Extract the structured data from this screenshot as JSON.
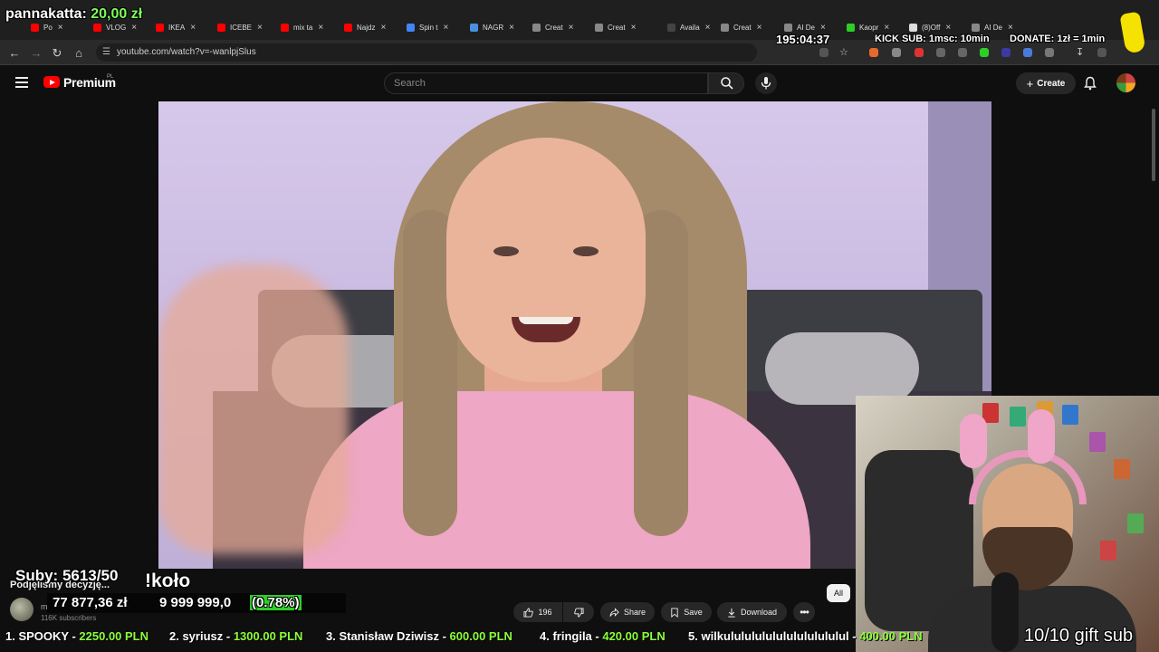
{
  "browser": {
    "tabs": [
      {
        "label": "Po",
        "color": "#ff0000"
      },
      {
        "label": "VLOG",
        "color": "#ff0000"
      },
      {
        "label": "IKEA",
        "color": "#ff0000"
      },
      {
        "label": "ICEBE",
        "color": "#ff0000"
      },
      {
        "label": "mix ta",
        "color": "#ff0000"
      },
      {
        "label": "Najdz",
        "color": "#ff0000"
      },
      {
        "label": "Spin t",
        "color": "#4285f4"
      },
      {
        "label": "NAGR",
        "color": "#4a90e2"
      },
      {
        "label": "Creat",
        "color": "#888888"
      },
      {
        "label": "Creat",
        "color": "#888888"
      },
      {
        "label": "Availa",
        "color": "#444444"
      },
      {
        "label": "Creat",
        "color": "#888888"
      },
      {
        "label": "AI De",
        "color": "#888888"
      },
      {
        "label": "Kaopr",
        "color": "#2dcf26"
      },
      {
        "label": "(8)Off",
        "color": "#dddddd"
      },
      {
        "label": "AI De",
        "color": "#888888"
      }
    ],
    "url": "youtube.com/watch?v=-wanlpjSlus"
  },
  "youtube": {
    "logo_text": "Premium",
    "region": "PL",
    "search_placeholder": "Search",
    "create_label": "Create",
    "chip_all": "All",
    "likes": "196",
    "share": "Share",
    "save": "Save",
    "download": "Download",
    "video_title": "Podjęliśmy decyzję...",
    "channel_name": "m",
    "channel_subs": "116K subscribers"
  },
  "overlay": {
    "donor_name": "pannakatta:",
    "donor_amount": "20,00 zł",
    "timer": "195:04:37",
    "kick_sub": "KICK SUB: 1msc: 10min",
    "donate": "DONATE: 1zł = 1min",
    "subs": "Suby: 5613/50",
    "kolo": "!koło",
    "goal_current": "77 877,36 zł",
    "goal_max": "9 999 999,0",
    "goal_pct": "(0.78%)",
    "gift": "10/10 gift sub",
    "leaderboard": [
      {
        "rank": "1. SPOOKY - ",
        "amount": "2250.00 PLN"
      },
      {
        "rank": "2. syriusz - ",
        "amount": "1300.00 PLN"
      },
      {
        "rank": "3. Stanisław Dziwisz - ",
        "amount": "600.00 PLN"
      },
      {
        "rank": "4. fringila - ",
        "amount": "420.00 PLN"
      },
      {
        "rank": "5. wilkulululululululululululul - ",
        "amount": "400.00 PLN"
      }
    ]
  }
}
